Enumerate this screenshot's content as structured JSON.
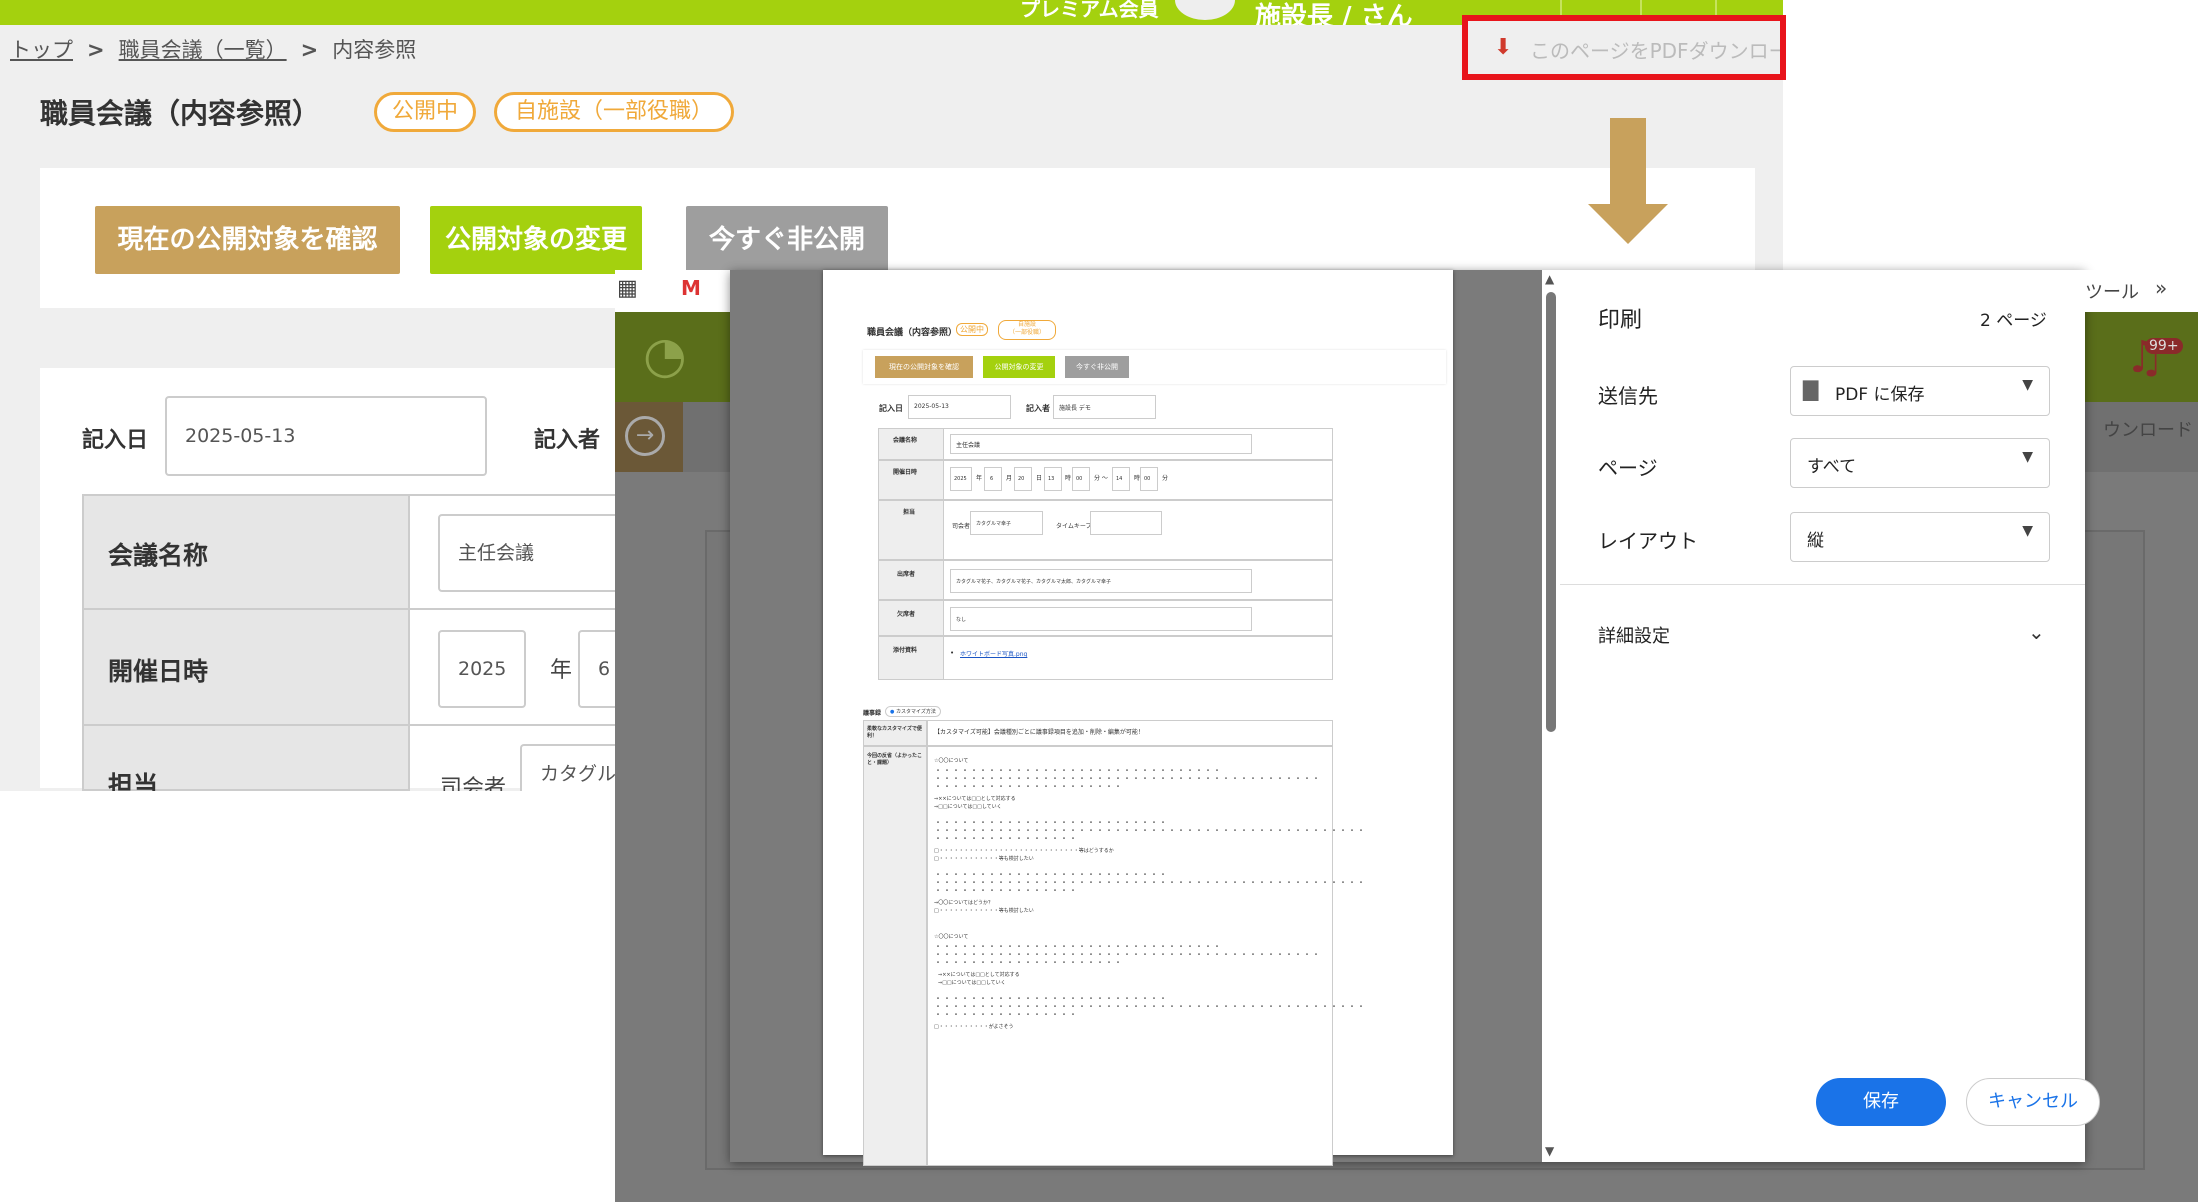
{
  "header": {
    "plan_label": "プレミアム会員",
    "user_name": "施設長 / さん"
  },
  "breadcrumb": {
    "top": "トップ",
    "list": "職員会議（一覧）",
    "sep": ">",
    "current": "内容参照"
  },
  "pdf_download": {
    "label": "このページをPDFダウンロード"
  },
  "page": {
    "title": "職員会議（内容参照）",
    "badges": [
      "公開中",
      "自施設（一部役職）"
    ]
  },
  "actions": {
    "confirm_label": "現在の公開対象を確認",
    "change_label": "公開対象の変更",
    "unpublish_label": "今すぐ非公開"
  },
  "form": {
    "entry_date_label": "記入日",
    "entry_date_value": "2025-05-13",
    "entry_person_label": "記入者",
    "meeting_name_label": "会議名称",
    "meeting_name_value": "主任会議",
    "datetime_label": "開催日時",
    "year_value": "2025",
    "year_unit": "年",
    "month_value": "6",
    "charge_label": "担当",
    "chair_label": "司会者",
    "chair_value": "カタグル"
  },
  "bg_window": {
    "tab_tools": "ツール",
    "tab_more": "»",
    "notif": "99+",
    "download_fragment": "ウンロード"
  },
  "preview": {
    "title": "職員会議（内容参照）",
    "badge1": "公開中",
    "badge2a": "自施設",
    "badge2b": "（一部役職）",
    "btn1": "現在の公開対象を確認",
    "btn2": "公開対象の変更",
    "btn3": "今すぐ非公開",
    "entry_date_label": "記入日",
    "entry_date_value": "2025-05-13",
    "entry_person_label": "記入者",
    "entry_person_value": "施設長 デモ",
    "meeting_name_label": "会議名称",
    "meeting_name_value": "主任会議",
    "datetime_label": "開催日時",
    "year": "2025",
    "nen": "年",
    "month": "6",
    "tsuki": "月",
    "day": "20",
    "nichi": "日",
    "hour1": "13",
    "ji1": "時",
    "min1": "00",
    "fun1": "分 〜",
    "hour2": "14",
    "ji2": "時",
    "min2": "00",
    "fun2": "分",
    "charge_label": "担当",
    "chair_label": "司会者",
    "chair_value": "カタグルマ幸子",
    "timekeeper_label": "タイムキープ",
    "attendees_label": "出席者",
    "attendees_value": "カタグルマ花子、カタグルマ花子、カタグルマ太郎、カタグルマ幸子",
    "absent_label": "欠席者",
    "absent_value": "なし",
    "attach_label": "添付資料",
    "attach_value": "ホワイトボード写真.png",
    "minutes_label": "議事録",
    "customize_label": "カスタマイズ方法",
    "flex_label": "柔軟なカスタマイズで便利！",
    "flex_value": "【カスタマイズ可能】会議種別ごとに議事録項目を追加・削除・編集が可能！",
    "today_label": "今回の反省（よかったこと・課題）",
    "line_oo": "☆〇〇について",
    "line_xx": "⇒××については□□として対応する",
    "line_sq": "⇒□□については□□していく",
    "line_q1": "□・・・・・・・・・・・・・・・・・・・・・・・・・・・・等はどうするか",
    "line_q2": "□・・・・・・・・・・・・等も検討したい",
    "line_q3": "⇒〇〇についてはどうか？",
    "line_q4": "□・・・・・・・・・・・・等も検討したい",
    "line_oo2": "☆〇〇について",
    "line_xx2": "⇒××については□□として対応する",
    "line_sq2": "⇒□□については□□していく",
    "line_last": "□・・・・・・・・・・がよさそう"
  },
  "print_dialog": {
    "title": "印刷",
    "page_count": "2 ページ",
    "dest_label": "送信先",
    "dest_value": "PDF に保存",
    "pages_label": "ページ",
    "pages_value": "すべて",
    "layout_label": "レイアウト",
    "layout_value": "縦",
    "more_label": "詳細設定",
    "save_label": "保存",
    "cancel_label": "キャンセル"
  },
  "colors": {
    "lime": "#a4d10e",
    "brown": "#c8a15c",
    "gray_btn": "#9e9e9e",
    "badge": "#f0a93a",
    "highlight": "#e8141b",
    "primary": "#1a73e8"
  }
}
